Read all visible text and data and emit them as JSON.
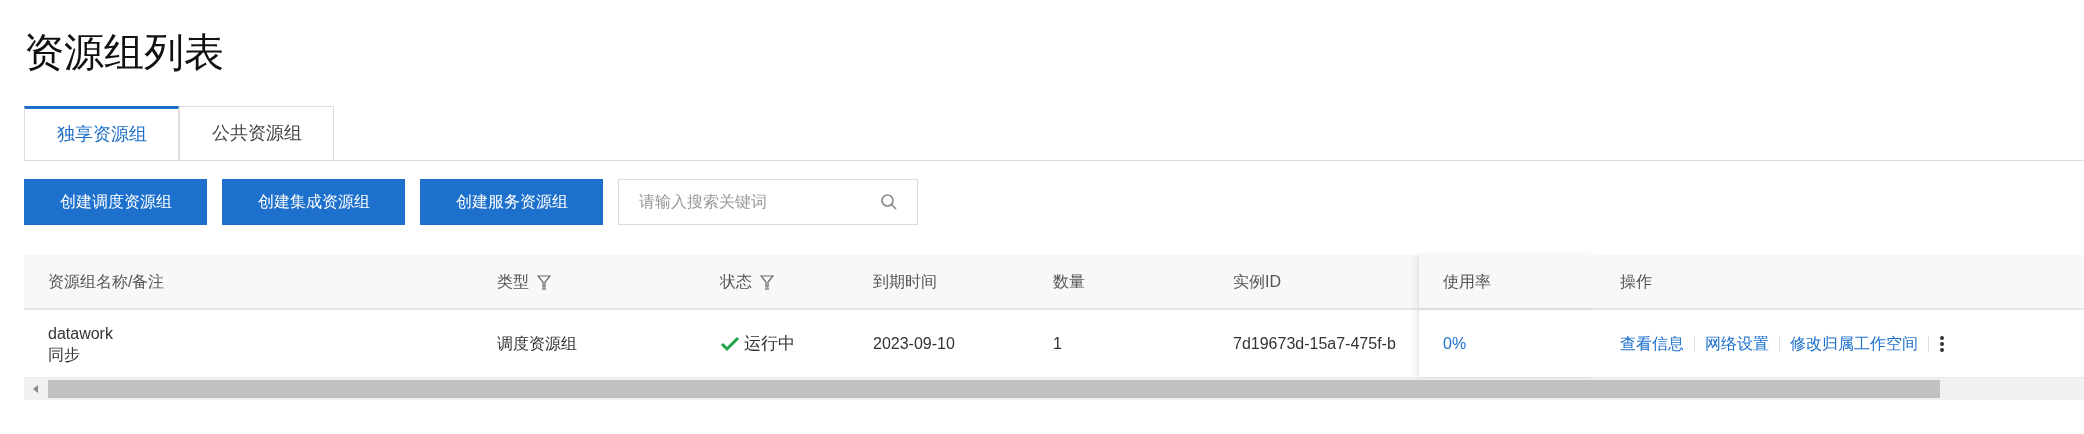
{
  "title": "资源组列表",
  "tabs": [
    {
      "label": "独享资源组",
      "selected": true
    },
    {
      "label": "公共资源组",
      "selected": false
    }
  ],
  "buttons": [
    "创建调度资源组",
    "创建集成资源组",
    "创建服务资源组"
  ],
  "search": {
    "placeholder": "请输入搜索关键词"
  },
  "table": {
    "columns": [
      {
        "label": "资源组名称/备注",
        "kind": "plain"
      },
      {
        "label": "类型",
        "kind": "filterable"
      },
      {
        "label": "状态",
        "kind": "filterable"
      },
      {
        "label": "到期时间",
        "kind": "plain"
      },
      {
        "label": "数量",
        "kind": "plain"
      },
      {
        "label": "实例ID",
        "kind": "plain"
      },
      {
        "label": "使用率",
        "kind": "plain"
      },
      {
        "label": "操作",
        "kind": "plain"
      }
    ],
    "rows": [
      {
        "name": "datawork",
        "note": "同步",
        "type": "调度资源组",
        "status": {
          "label": "运行中",
          "kind": "running"
        },
        "expires": "2023-09-10",
        "count": "1",
        "instance_id": "7d19673d-15a7-475f-b",
        "usage": "0%",
        "actions": [
          "查看信息",
          "网络设置",
          "修改归属工作空间"
        ]
      }
    ]
  }
}
